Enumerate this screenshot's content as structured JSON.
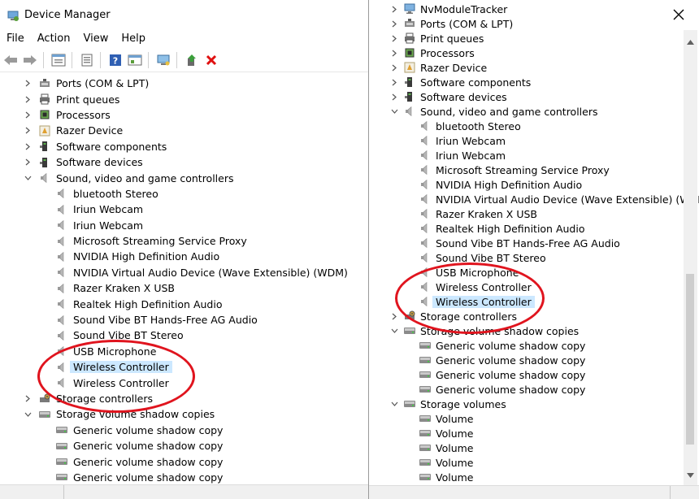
{
  "left_window": {
    "title": "Device Manager",
    "menu": [
      "File",
      "Action",
      "View",
      "Help"
    ],
    "toolbar_icons": [
      "back-icon",
      "forward-icon",
      "properties-icon",
      "show-hidden-icon",
      "help-icon",
      "update-driver-icon",
      "scan-hardware-icon",
      "enable-device-icon",
      "uninstall-icon"
    ],
    "tree": [
      {
        "label": "Ports (COM & LPT)",
        "level": 1,
        "arrow": "right",
        "icon": "port"
      },
      {
        "label": "Print queues",
        "level": 1,
        "arrow": "right",
        "icon": "printer"
      },
      {
        "label": "Processors",
        "level": 1,
        "arrow": "right",
        "icon": "chip"
      },
      {
        "label": "Razer Device",
        "level": 1,
        "arrow": "right",
        "icon": "razer"
      },
      {
        "label": "Software components",
        "level": 1,
        "arrow": "right",
        "icon": "software"
      },
      {
        "label": "Software devices",
        "level": 1,
        "arrow": "right",
        "icon": "software"
      },
      {
        "label": "Sound, video and game controllers",
        "level": 1,
        "arrow": "down",
        "icon": "speaker"
      },
      {
        "label": "bluetooth Stereo",
        "level": 2,
        "arrow": "",
        "icon": "speaker"
      },
      {
        "label": "Iriun Webcam",
        "level": 2,
        "arrow": "",
        "icon": "speaker"
      },
      {
        "label": "Iriun Webcam",
        "level": 2,
        "arrow": "",
        "icon": "speaker"
      },
      {
        "label": "Microsoft Streaming Service Proxy",
        "level": 2,
        "arrow": "",
        "icon": "speaker"
      },
      {
        "label": "NVIDIA High Definition Audio",
        "level": 2,
        "arrow": "",
        "icon": "speaker"
      },
      {
        "label": "NVIDIA Virtual Audio Device (Wave Extensible) (WDM)",
        "level": 2,
        "arrow": "",
        "icon": "speaker"
      },
      {
        "label": "Razer Kraken X USB",
        "level": 2,
        "arrow": "",
        "icon": "speaker"
      },
      {
        "label": "Realtek High Definition Audio",
        "level": 2,
        "arrow": "",
        "icon": "speaker"
      },
      {
        "label": "Sound Vibe BT Hands-Free AG Audio",
        "level": 2,
        "arrow": "",
        "icon": "speaker"
      },
      {
        "label": "Sound Vibe BT Stereo",
        "level": 2,
        "arrow": "",
        "icon": "speaker"
      },
      {
        "label": "USB Microphone",
        "level": 2,
        "arrow": "",
        "icon": "speaker"
      },
      {
        "label": "Wireless Controller",
        "level": 2,
        "arrow": "",
        "icon": "speaker",
        "selected": true
      },
      {
        "label": "Wireless Controller",
        "level": 2,
        "arrow": "",
        "icon": "speaker"
      },
      {
        "label": "Storage controllers",
        "level": 1,
        "arrow": "right",
        "icon": "storage"
      },
      {
        "label": "Storage volume shadow copies",
        "level": 1,
        "arrow": "down",
        "icon": "disk"
      },
      {
        "label": "Generic volume shadow copy",
        "level": 2,
        "arrow": "",
        "icon": "disk"
      },
      {
        "label": "Generic volume shadow copy",
        "level": 2,
        "arrow": "",
        "icon": "disk"
      },
      {
        "label": "Generic volume shadow copy",
        "level": 2,
        "arrow": "",
        "icon": "disk"
      },
      {
        "label": "Generic volume shadow copy",
        "level": 2,
        "arrow": "",
        "icon": "disk"
      }
    ]
  },
  "right_window": {
    "close_icon": "close-icon",
    "tree": [
      {
        "label": "NvModuleTracker",
        "level": 1,
        "arrow": "right",
        "icon": "monitor"
      },
      {
        "label": "Ports (COM & LPT)",
        "level": 1,
        "arrow": "right",
        "icon": "port"
      },
      {
        "label": "Print queues",
        "level": 1,
        "arrow": "right",
        "icon": "printer"
      },
      {
        "label": "Processors",
        "level": 1,
        "arrow": "right",
        "icon": "chip"
      },
      {
        "label": "Razer Device",
        "level": 1,
        "arrow": "right",
        "icon": "razer"
      },
      {
        "label": "Software components",
        "level": 1,
        "arrow": "right",
        "icon": "software"
      },
      {
        "label": "Software devices",
        "level": 1,
        "arrow": "right",
        "icon": "software"
      },
      {
        "label": "Sound, video and game controllers",
        "level": 1,
        "arrow": "down",
        "icon": "speaker"
      },
      {
        "label": "bluetooth Stereo",
        "level": 2,
        "arrow": "",
        "icon": "speaker"
      },
      {
        "label": "Iriun Webcam",
        "level": 2,
        "arrow": "",
        "icon": "speaker"
      },
      {
        "label": "Iriun Webcam",
        "level": 2,
        "arrow": "",
        "icon": "speaker"
      },
      {
        "label": "Microsoft Streaming Service Proxy",
        "level": 2,
        "arrow": "",
        "icon": "speaker"
      },
      {
        "label": "NVIDIA High Definition Audio",
        "level": 2,
        "arrow": "",
        "icon": "speaker"
      },
      {
        "label": "NVIDIA Virtual Audio Device (Wave Extensible) (WDM)",
        "level": 2,
        "arrow": "",
        "icon": "speaker"
      },
      {
        "label": "Razer Kraken X USB",
        "level": 2,
        "arrow": "",
        "icon": "speaker"
      },
      {
        "label": "Realtek High Definition Audio",
        "level": 2,
        "arrow": "",
        "icon": "speaker"
      },
      {
        "label": "Sound Vibe BT Hands-Free AG Audio",
        "level": 2,
        "arrow": "",
        "icon": "speaker"
      },
      {
        "label": "Sound Vibe BT Stereo",
        "level": 2,
        "arrow": "",
        "icon": "speaker"
      },
      {
        "label": "USB Microphone",
        "level": 2,
        "arrow": "",
        "icon": "speaker"
      },
      {
        "label": "Wireless Controller",
        "level": 2,
        "arrow": "",
        "icon": "speaker"
      },
      {
        "label": "Wireless Controller",
        "level": 2,
        "arrow": "",
        "icon": "speaker",
        "selected": true
      },
      {
        "label": "Storage controllers",
        "level": 1,
        "arrow": "right",
        "icon": "storage"
      },
      {
        "label": "Storage volume shadow copies",
        "level": 1,
        "arrow": "down",
        "icon": "disk"
      },
      {
        "label": "Generic volume shadow copy",
        "level": 2,
        "arrow": "",
        "icon": "disk"
      },
      {
        "label": "Generic volume shadow copy",
        "level": 2,
        "arrow": "",
        "icon": "disk"
      },
      {
        "label": "Generic volume shadow copy",
        "level": 2,
        "arrow": "",
        "icon": "disk"
      },
      {
        "label": "Generic volume shadow copy",
        "level": 2,
        "arrow": "",
        "icon": "disk"
      },
      {
        "label": "Storage volumes",
        "level": 1,
        "arrow": "down",
        "icon": "disk"
      },
      {
        "label": "Volume",
        "level": 2,
        "arrow": "",
        "icon": "disk"
      },
      {
        "label": "Volume",
        "level": 2,
        "arrow": "",
        "icon": "disk"
      },
      {
        "label": "Volume",
        "level": 2,
        "arrow": "",
        "icon": "disk"
      },
      {
        "label": "Volume",
        "level": 2,
        "arrow": "",
        "icon": "disk"
      },
      {
        "label": "Volume",
        "level": 2,
        "arrow": "",
        "icon": "disk"
      }
    ]
  },
  "colors": {
    "selection": "#cce8ff",
    "annotation_circle": "#e0141e"
  }
}
